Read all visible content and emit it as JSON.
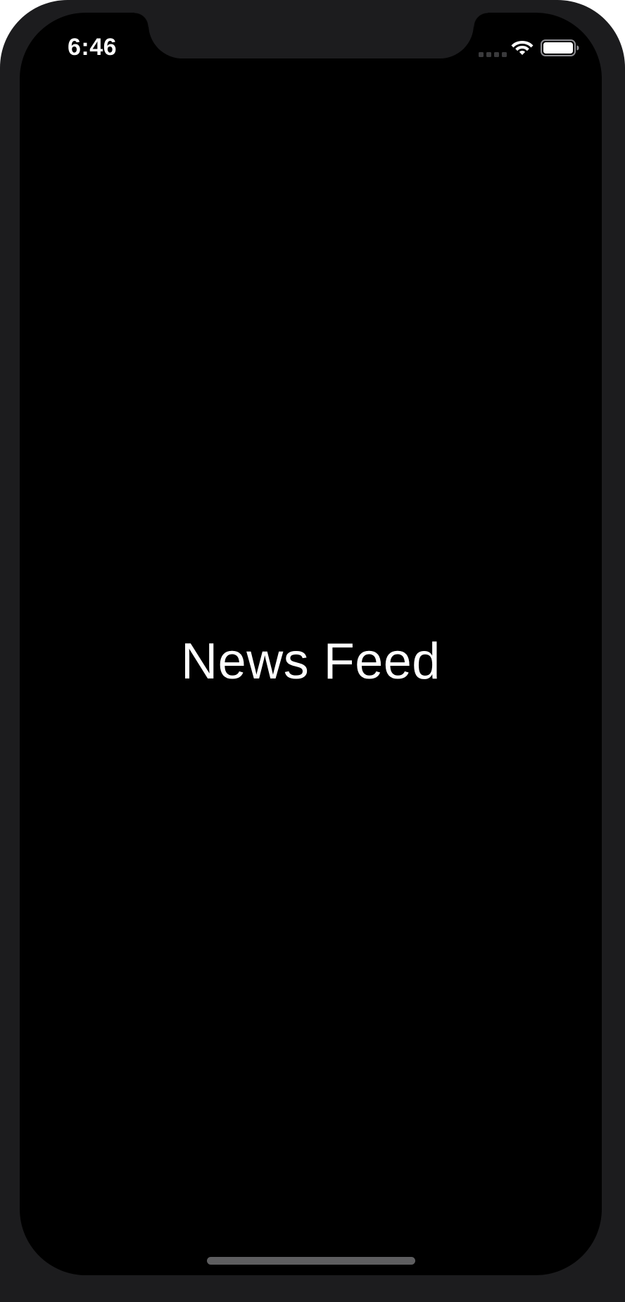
{
  "status_bar": {
    "time": "6:46",
    "icons": {
      "signal": "cellular-signal-icon",
      "wifi": "wifi-icon",
      "battery": "battery-icon"
    }
  },
  "main": {
    "title": "News Feed"
  },
  "colors": {
    "frame": "#1c1c1e",
    "screen_background": "#000000",
    "text": "#ffffff",
    "home_indicator": "#5e5e60"
  }
}
